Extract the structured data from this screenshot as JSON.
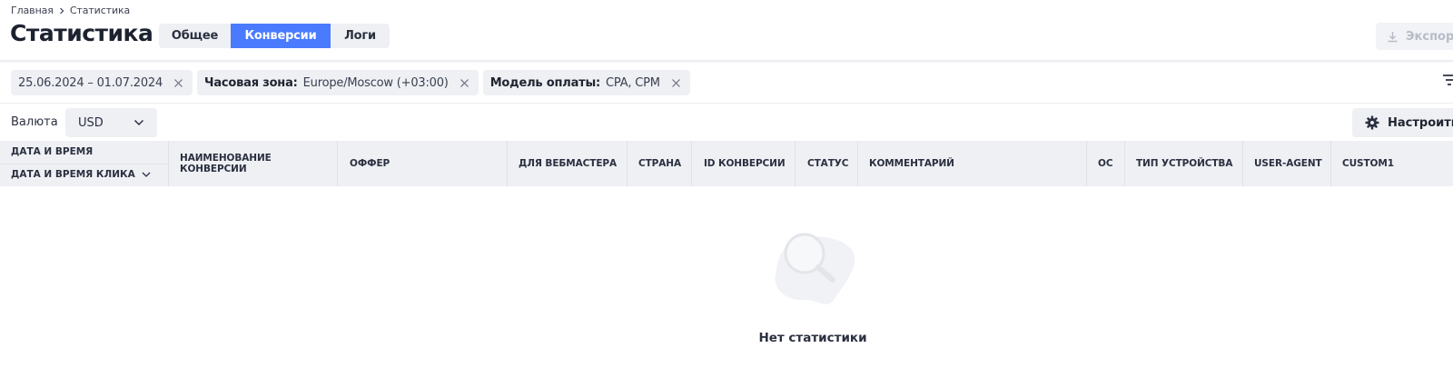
{
  "breadcrumb": {
    "home": "Главная",
    "current": "Статистика",
    "separator_icon": "chevron-right-icon"
  },
  "page": {
    "title": "Статистика"
  },
  "tabs": [
    {
      "label": "Общее",
      "active": false
    },
    {
      "label": "Конверсии",
      "active": true
    },
    {
      "label": "Логи",
      "active": false
    }
  ],
  "export": {
    "label": "Экспор",
    "icon": "download-icon",
    "disabled": true
  },
  "filters": {
    "date_range": {
      "value": "25.06.2024 – 01.07.2024"
    },
    "timezone": {
      "label": "Часовая зона:",
      "value": "Europe/Moscow (+03:00)"
    },
    "payment_model": {
      "label": "Модель оплаты:",
      "value": "CPA, CPM"
    },
    "remove_icon": "close-icon",
    "filter_icon": "filter-icon"
  },
  "currency": {
    "label": "Валюта",
    "selected": "USD",
    "icon": "chevron-down-icon"
  },
  "settings": {
    "label": "Настроить",
    "icon": "gear-icon"
  },
  "table": {
    "first_col": {
      "row1": "ДАТА И ВРЕМЯ",
      "row2": "ДАТА И ВРЕМЯ КЛИКА",
      "dropdown_icon": "chevron-down-icon"
    },
    "columns": [
      "НАИМЕНОВАНИЕ КОНВЕРСИИ",
      "ОФФЕР",
      "ДЛЯ ВЕБМАСТЕРА",
      "СТРАНА",
      "ID КОНВЕРСИИ",
      "СТАТУС",
      "КОММЕНТАРИЙ",
      "ОС",
      "ТИП УСТРОЙСТВА",
      "USER-AGENT",
      "CUSTOM1"
    ]
  },
  "empty_state": {
    "text": "Нет статистики",
    "icon": "search-magnifier-icon"
  },
  "colors": {
    "accent": "#4a7bff",
    "chip_bg": "#eef0f4",
    "text": "#2b3040"
  }
}
